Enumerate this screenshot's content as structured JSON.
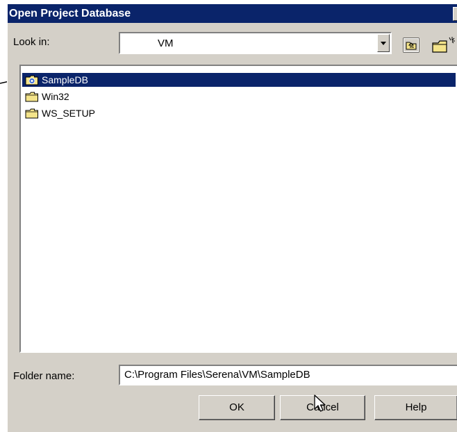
{
  "window": {
    "title": "Open Project Database",
    "close_glyph": "✕"
  },
  "look_in": {
    "label": "Look in:",
    "value": "VM"
  },
  "toolbar": {
    "up_icon": "folder-up-icon",
    "new_folder_icon": "new-folder-icon"
  },
  "files": [
    {
      "name": "SampleDB",
      "icon": "database-folder-icon",
      "selected": true
    },
    {
      "name": "Win32",
      "icon": "folder-icon",
      "selected": false
    },
    {
      "name": "WS_SETUP",
      "icon": "folder-icon",
      "selected": false
    }
  ],
  "folder_name": {
    "label": "Folder name:",
    "value": "C:\\Program Files\\Serena\\VM\\SampleDB"
  },
  "buttons": {
    "ok": "OK",
    "cancel": "Cancel",
    "help": "Help"
  },
  "colors": {
    "titlebar": "#0a246a",
    "selection": "#0a246a",
    "face": "#d4d0c8"
  }
}
